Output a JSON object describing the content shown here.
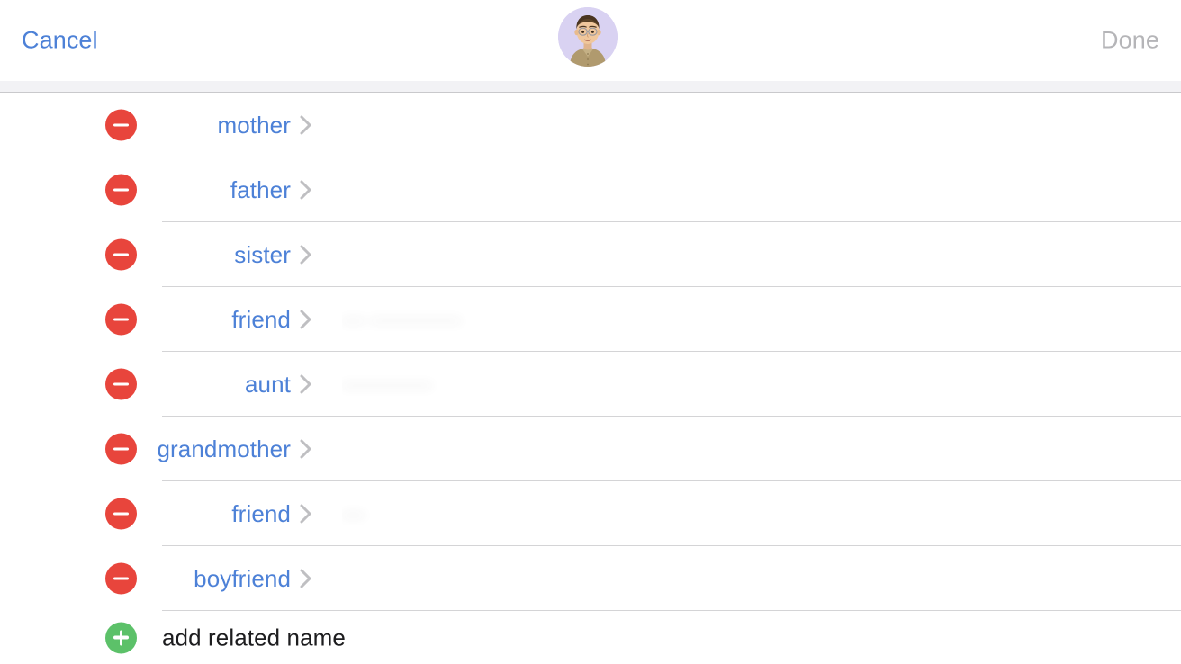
{
  "navbar": {
    "cancel_label": "Cancel",
    "done_label": "Done",
    "done_enabled": false,
    "avatar_name": "contact-avatar-memoji",
    "avatar_bg_color": "#d9d2f2"
  },
  "colors": {
    "accent_blue": "#4d81d7",
    "disabled_gray": "#b5b5b8",
    "delete_red": "#e8453c",
    "add_green": "#5cc169",
    "separator": "#d4d4d6",
    "band": "#f2f2f5"
  },
  "list": {
    "rows": [
      {
        "label": "mother",
        "value": "",
        "info_icon": "info-circle-icon",
        "delete_icon": "minus-circle-icon",
        "chevron": "chevron-right-icon"
      },
      {
        "label": "father",
        "value": "",
        "info_icon": "info-circle-icon",
        "delete_icon": "minus-circle-icon",
        "chevron": "chevron-right-icon"
      },
      {
        "label": "sister",
        "value": "",
        "info_icon": "info-circle-icon",
        "delete_icon": "minus-circle-icon",
        "chevron": "chevron-right-icon"
      },
      {
        "label": "friend",
        "value": "— ————",
        "info_icon": "info-circle-icon",
        "delete_icon": "minus-circle-icon",
        "chevron": "chevron-right-icon"
      },
      {
        "label": "aunt",
        "value": "————",
        "info_icon": "info-circle-icon",
        "delete_icon": "minus-circle-icon",
        "chevron": "chevron-right-icon"
      },
      {
        "label": "grandmother",
        "value": "",
        "info_icon": "info-circle-icon",
        "delete_icon": "minus-circle-icon",
        "chevron": "chevron-right-icon"
      },
      {
        "label": "friend",
        "value": "—",
        "info_icon": "info-circle-icon",
        "delete_icon": "minus-circle-icon",
        "chevron": "chevron-right-icon"
      },
      {
        "label": "boyfriend",
        "value": "",
        "info_icon": "info-circle-icon",
        "delete_icon": "minus-circle-icon",
        "chevron": "chevron-right-icon"
      }
    ]
  },
  "add_row": {
    "label": "add related name",
    "icon": "plus-circle-icon"
  }
}
